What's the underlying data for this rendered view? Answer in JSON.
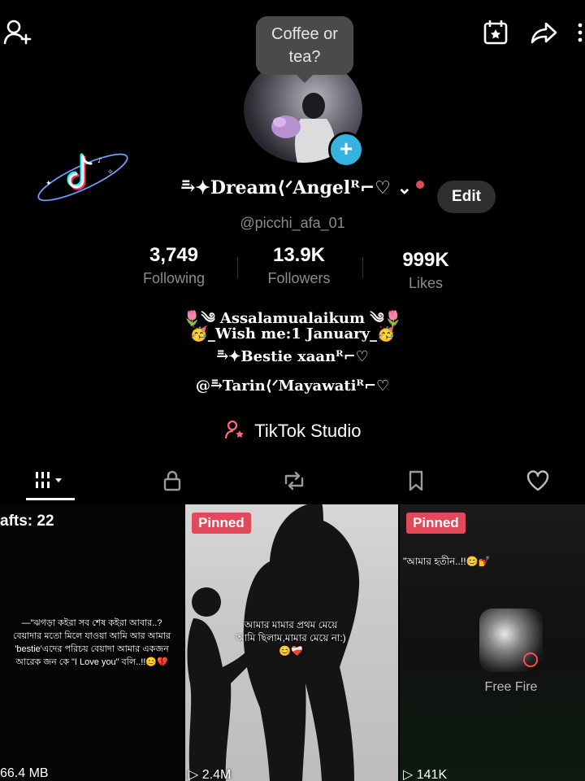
{
  "header": {
    "tooltip": "Coffee or tea?"
  },
  "profile": {
    "display_name": "⥱✦Dream⟨ᐟAngelᴿ⌐♡ ⌄",
    "username": "@picchi_afa_01",
    "edit_label": "Edit"
  },
  "stats": [
    {
      "value": "3,749",
      "label": "Following"
    },
    {
      "value": "13.9K",
      "label": "Followers"
    },
    {
      "value": "999K",
      "label": "Likes"
    }
  ],
  "bio": [
    "🌷༄ Assalamualaikum ༄🌷",
    "🥳_Wish me:1 January_🥳",
    "⥱✦Bestie xaanᴿ⌐♡",
    "@⥱Tarin⟨ᐟMayawatiᴿ⌐♡"
  ],
  "studio": {
    "label": "TikTok Studio"
  },
  "tiles": [
    {
      "corner_text": "afts: 22",
      "caption": "—\"ঝগড়া কইরা সব শেষ কইরা আবার..?\nবেয়াদার মতো মিলে যাওয়া আমি আর আমার\n'bestie'এদের পরিচয় বেয়াদা আমার একজন\nআরেক জন কে \"I Love you\" বলি..!!😊💔",
      "footer": "66.4 MB"
    },
    {
      "badge": "Pinned",
      "caption": "আমার মামার প্রথম মেয়ে\nআমি ছিলাম,মামার মেয়ে না:)\n😊❤️‍🩹",
      "footer": "▷ 2.4M"
    },
    {
      "badge": "Pinned",
      "caption": "\"আমার হতীন..!!😊💅",
      "app_label": "Free Fire",
      "footer": "▷ 141K"
    }
  ],
  "colors": {
    "background": "#000000",
    "pinned_badge": "#e14a5b",
    "add_badge": "#34b3e0",
    "studio_icon": "#ff6b7d"
  }
}
